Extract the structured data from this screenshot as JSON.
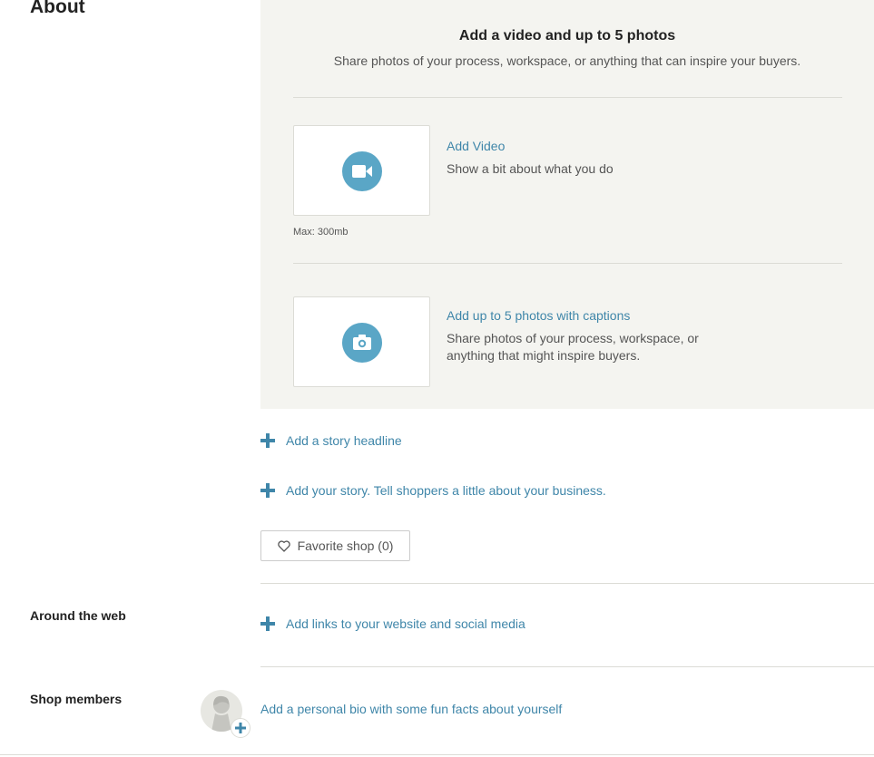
{
  "about": {
    "title": "About"
  },
  "media": {
    "title": "Add a video and up to 5 photos",
    "subtitle": "Share photos of your process, workspace, or anything that can inspire your buyers.",
    "video": {
      "link": "Add Video",
      "description": "Show a bit about what you do",
      "max_size": "Max: 300mb",
      "icon": "video-camera-icon"
    },
    "photos": {
      "link": "Add up to 5 photos with captions",
      "description": "Share photos of your process, workspace, or anything that might inspire buyers.",
      "icon": "camera-icon"
    }
  },
  "story": {
    "headline_link": "Add a story headline",
    "story_link": "Add your story. Tell shoppers a little about your business."
  },
  "favorite": {
    "label": "Favorite shop (0)",
    "icon": "heart-icon"
  },
  "around_web": {
    "label": "Around the web",
    "link": "Add links to your website and social media"
  },
  "shop_members": {
    "label": "Shop members",
    "bio_link": "Add a personal bio with some fun facts about yourself",
    "avatar_icon": "person-silhouette-icon"
  },
  "colors": {
    "link": "#3f86a9",
    "icon_circle": "#5aa6c6",
    "panel_bg": "#f4f4f0"
  }
}
